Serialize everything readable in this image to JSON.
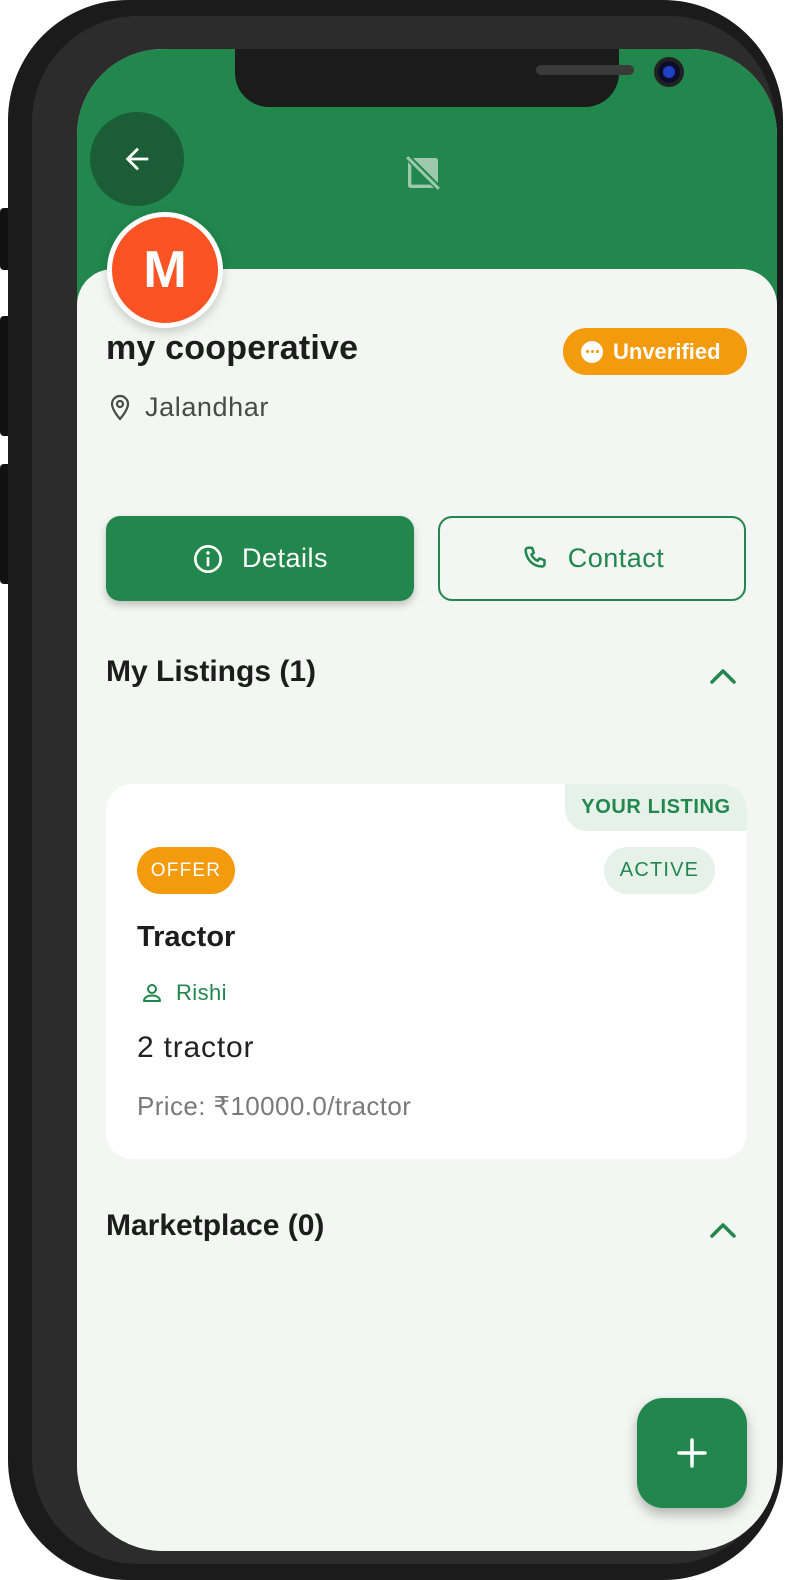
{
  "header": {
    "back_icon": "arrow-left-icon",
    "cover_icon": "image-not-supported-icon",
    "color": "#21874c"
  },
  "profile": {
    "avatar_letter": "M",
    "avatar_color": "#fb5323",
    "name": "my cooperative",
    "status_badge": "Unverified",
    "status_color": "#f39a0d",
    "location": "Jalandhar"
  },
  "actions": {
    "details_label": "Details",
    "contact_label": "Contact"
  },
  "sections": {
    "my_listings_title": "My Listings (1)",
    "marketplace_title": "Marketplace (0)"
  },
  "listing": {
    "owner_tag": "YOUR LISTING",
    "type_chip": "OFFER",
    "status_chip": "ACTIVE",
    "title": "Tractor",
    "seller": "Rishi",
    "quantity": "2 tractor",
    "price": "Price: ₹10000.0/tractor"
  },
  "fab": {
    "icon": "plus-icon"
  }
}
